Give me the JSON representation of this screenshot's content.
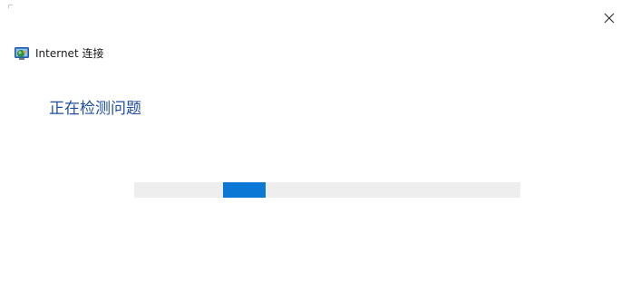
{
  "window": {
    "title": "Internet 连接",
    "icon": "internet-connection-icon",
    "close_glyph": "close-icon"
  },
  "main": {
    "heading": "正在检测问题"
  },
  "progress": {
    "mode": "indeterminate",
    "chunk_start_fraction": 0.23,
    "chunk_width_fraction": 0.11,
    "track_color": "#eeeeee",
    "fill_color": "#0a78d4"
  },
  "colors": {
    "accent": "#0a78d4",
    "heading_text": "#1f4e9e"
  }
}
